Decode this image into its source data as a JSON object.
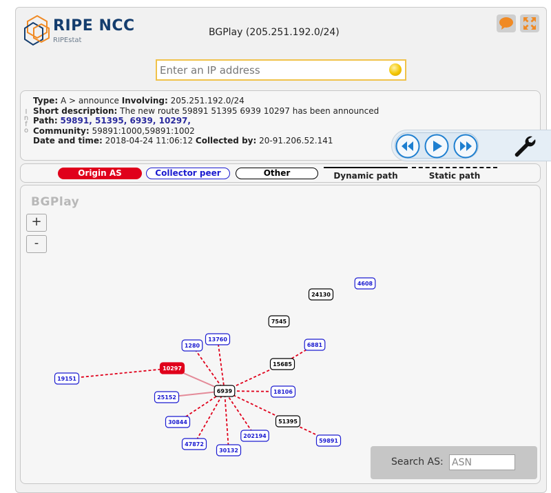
{
  "header": {
    "logo_name": "RIPE NCC",
    "logo_sub": "RIPEstat",
    "title": "BGPlay (205.251.192.0/24)",
    "feedback_icon": "speech-bubble-icon",
    "fullscreen_icon": "fullscreen-icon"
  },
  "search": {
    "ip_placeholder": "Enter an IP address",
    "ip_value": ""
  },
  "info": {
    "side_label": [
      "I",
      "n",
      "f",
      "o"
    ],
    "type_label": "Type:",
    "type_value": " A > announce ",
    "involving_label": "Involving:",
    "involving_value": " 205.251.192.0/24",
    "short_desc_label": "Short description:",
    "short_desc_value": " The new route 59891 51395 6939 10297 has been announced",
    "path_label": "Path:",
    "path_items": [
      "59891",
      "51395",
      "6939",
      "10297"
    ],
    "community_label": "Community:",
    "community_value": " 59891:1000,59891:1002",
    "date_label": "Date and time:",
    "date_value": " 2018-04-24 11:06:12 ",
    "collected_label": "Collected by:",
    "collected_value": " 20-91.206.52.141"
  },
  "controls": {
    "prev_icon": "rewind-icon",
    "play_icon": "play-icon",
    "next_icon": "fast-forward-icon",
    "settings_icon": "wrench-icon"
  },
  "legend": {
    "origin": "Origin AS",
    "collector": "Collector peer",
    "other": "Other",
    "dynamic": "Dynamic path",
    "static": "Static path"
  },
  "graph": {
    "watermark": "BGPlay",
    "zoom_in": "+",
    "zoom_out": "-",
    "search_label": "Search AS:",
    "search_placeholder": "ASN",
    "colors": {
      "origin": "#e0001b",
      "collector": "#1a1ad0",
      "other": "#000000",
      "static_path": "#e0001b",
      "dynamic_path": "#e48a98"
    }
  },
  "nodes": [
    {
      "asn": "4608",
      "kind": "collector"
    },
    {
      "asn": "24130",
      "kind": "other"
    },
    {
      "asn": "7545",
      "kind": "other"
    },
    {
      "asn": "6881",
      "kind": "collector"
    },
    {
      "asn": "1280",
      "kind": "collector"
    },
    {
      "asn": "13760",
      "kind": "collector"
    },
    {
      "asn": "15685",
      "kind": "other"
    },
    {
      "asn": "10297",
      "kind": "origin"
    },
    {
      "asn": "19151",
      "kind": "collector"
    },
    {
      "asn": "6939",
      "kind": "other"
    },
    {
      "asn": "18106",
      "kind": "collector"
    },
    {
      "asn": "25152",
      "kind": "collector"
    },
    {
      "asn": "51395",
      "kind": "other"
    },
    {
      "asn": "30844",
      "kind": "collector"
    },
    {
      "asn": "202194",
      "kind": "collector"
    },
    {
      "asn": "59891",
      "kind": "collector"
    },
    {
      "asn": "47872",
      "kind": "collector"
    },
    {
      "asn": "30132",
      "kind": "collector"
    }
  ],
  "edges": [
    {
      "from": "19151",
      "to": "10297",
      "style": "static"
    },
    {
      "from": "10297",
      "to": "6939",
      "style": "dynamic"
    },
    {
      "from": "25152",
      "to": "6939",
      "style": "dynamic"
    },
    {
      "from": "1280",
      "to": "6939",
      "style": "static"
    },
    {
      "from": "13760",
      "to": "6939",
      "style": "static"
    },
    {
      "from": "15685",
      "to": "6939",
      "style": "static"
    },
    {
      "from": "6881",
      "to": "15685",
      "style": "static"
    },
    {
      "from": "18106",
      "to": "6939",
      "style": "static"
    },
    {
      "from": "51395",
      "to": "6939",
      "style": "static"
    },
    {
      "from": "59891",
      "to": "51395",
      "style": "static"
    },
    {
      "from": "30844",
      "to": "6939",
      "style": "static"
    },
    {
      "from": "202194",
      "to": "6939",
      "style": "static"
    },
    {
      "from": "47872",
      "to": "6939",
      "style": "static"
    },
    {
      "from": "30132",
      "to": "6939",
      "style": "static"
    }
  ]
}
